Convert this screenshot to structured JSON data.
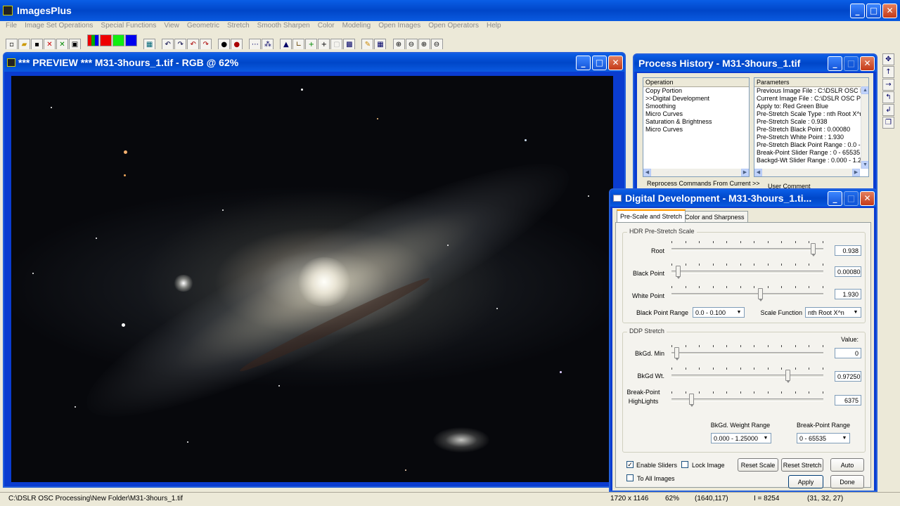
{
  "app": {
    "title": "ImagesPlus"
  },
  "menu": [
    "File",
    "Image Set Operations",
    "Special Functions",
    "View",
    "Geometric",
    "Stretch",
    "Smooth Sharpen",
    "Color",
    "Modeling",
    "Open Images",
    "Open Operators",
    "Help"
  ],
  "preview": {
    "title": "*** PREVIEW *** M31-3hours_1.tif - RGB @ 62%"
  },
  "history": {
    "title": "Process History - M31-3hours_1.tif",
    "op_header": "Operation",
    "operations": [
      "Copy Portion",
      ">>Digital Development",
      "Smoothing",
      "Micro Curves",
      "Saturation & Brightness",
      "Micro Curves"
    ],
    "param_header": "Parameters",
    "parameters": [
      "Previous Image File : C:\\DSLR OSC P",
      "Current Image File : C:\\DSLR OSC Pro",
      "Apply to:  Red Green Blue",
      "Pre-Stretch Scale Type : nth Root X^n",
      "Pre-Stretch Scale : 0.938",
      "Pre-Stretch Black Point : 0.00080",
      "Pre-Stretch White Point : 1.930",
      "Pre-Stretch Black Point Range : 0.0 -",
      "Break-Point Slider Range : 0 - 65535",
      "Backgd-Wt Slider Range : 0.000 - 1.2"
    ],
    "reprocess_label": "Reprocess Commands From Current >>",
    "comment_label": "User Comment"
  },
  "dd": {
    "title": "Digital Development - M31-3hours_1.ti...",
    "tabs": [
      "Pre-Scale and Stretch",
      "Color and Sharpness"
    ],
    "hdr_group": "HDR Pre-Stretch Scale",
    "root_label": "Root",
    "root_value": "0.938",
    "root_level": 0.95,
    "black_label": "Black Point",
    "black_value": "0.00080",
    "black_level": 0.03,
    "white_label": "White Point",
    "white_value": "1.930",
    "white_level": 0.59,
    "bp_range_label": "Black Point Range",
    "bp_range_value": "0.0 - 0.100",
    "scale_fn_label": "Scale Function",
    "scale_fn_value": "nth Root X^n",
    "ddp_group": "DDP Stretch",
    "value_label": "Value:",
    "bkmin_label": "BkGd. Min",
    "bkmin_value": "0",
    "bkmin_level": 0.02,
    "bkwt_label": "BkGd Wt.",
    "bkwt_value": "0.97250",
    "bkwt_level": 0.78,
    "bp_label": "Break-Point\nHighLights",
    "bp_value": "6375",
    "bp_level": 0.12,
    "bkwt_range_label": "BkGd. Weight Range",
    "bkwt_range_value": "0.000 - 1.25000",
    "bp_range2_label": "Break-Point Range",
    "bp_range2_value": "0 - 65535",
    "enable_sliders": "Enable Sliders",
    "lock_image": "Lock Image",
    "to_all_images": "To All Images",
    "reset_scale": "Reset Scale",
    "reset_stretch": "Reset Stretch",
    "auto": "Auto",
    "apply": "Apply",
    "done": "Done"
  },
  "status": {
    "path": "C:\\DSLR OSC Processing\\New Folder\\M31-3hours_1.tif",
    "dims": "1720 x 1146",
    "zoom": "62%",
    "coords": "(1640,117)",
    "index": "I = 8254",
    "rgb": "(31, 32, 27)"
  }
}
